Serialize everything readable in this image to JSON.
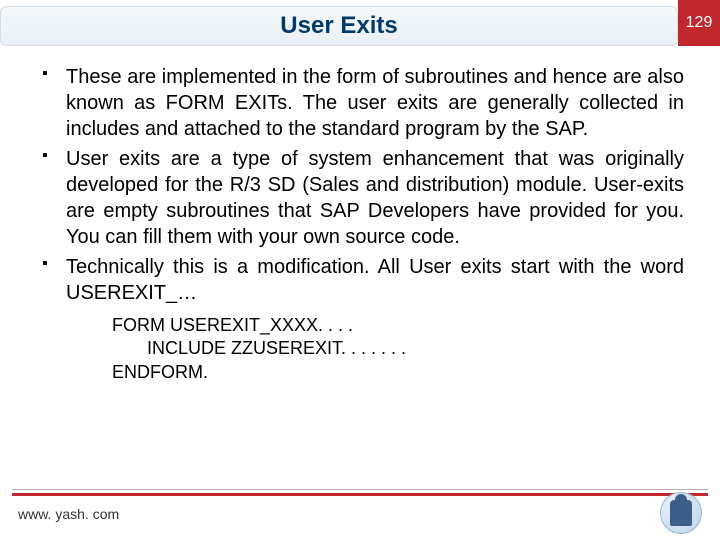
{
  "header": {
    "title": "User Exits",
    "page_number": "129"
  },
  "bullets": [
    "These are implemented in the form of subroutines and hence are also known as FORM EXITs. The user exits are generally collected in includes and attached to the standard program by the SAP.",
    "User exits are a type of system enhancement that was originally developed for the R/3 SD (Sales and distribution) module. User-exits are empty subroutines that SAP Developers have provided for you. You can fill them with your own source code.",
    "Technically this is a modification. All User exits start with the word USEREXIT_…"
  ],
  "code": "FORM USEREXIT_XXXX. . . .\n       INCLUDE ZZUSEREXIT. . . . . . .\nENDFORM.",
  "footer": {
    "site": "www. yash. com"
  }
}
